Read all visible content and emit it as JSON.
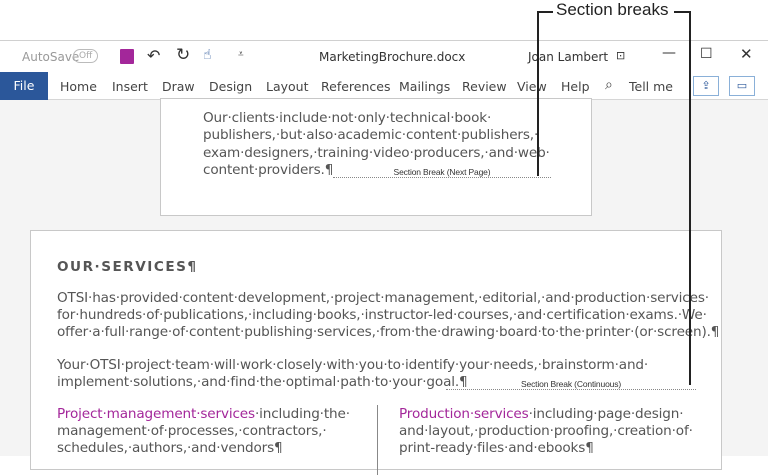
{
  "callout": {
    "label": "Section breaks"
  },
  "titlebar": {
    "autosave": "AutoSave",
    "toggle": "Off",
    "filename": "MarketingBrochure.docx",
    "user": "Joan Lambert"
  },
  "ribbon": {
    "tabs": [
      "File",
      "Home",
      "Insert",
      "Draw",
      "Design",
      "Layout",
      "References",
      "Mailings",
      "Review",
      "View",
      "Help"
    ],
    "tell_me": "Tell me"
  },
  "page1": {
    "lines": [
      "Our·clients·include·not·only·technical·book·",
      "publishers,·but·also·academic·content·publishers,·",
      "exam·designers,·training·video·producers,·and·web·",
      "content·providers.¶"
    ],
    "section_break": "Section Break (Next Page)"
  },
  "page2": {
    "heading": "OUR·SERVICES¶",
    "para1": [
      "OTSI·has·provided·content·development,·project·management,·editorial,·and·production·services·",
      "for·hundreds·of·publications,·including·books,·instructor-led·courses,·and·certification·exams.·We·",
      "offer·a·full·range·of·content·publishing·services,·from·the·drawing·board·to·the·printer·(or·screen).¶"
    ],
    "para2": [
      "Your·OTSI·project·team·will·work·closely·with·you·to·identify·your·needs,·brainstorm·and·",
      "implement·solutions,·and·find·the·optimal·path·to·your·goal.¶"
    ],
    "section_break": "Section Break (Continuous)",
    "col1": {
      "title": "Project·management·services",
      "lines": [
        "·including·the·",
        "management·of·processes,·contractors,·",
        "schedules,·authors,·and·vendors¶"
      ]
    },
    "col2": {
      "title": "Production·services",
      "lines": [
        "·including·page·design·",
        "and·layout,·production·proofing,·creation·of·",
        "print-ready·files·and·ebooks¶"
      ]
    }
  }
}
